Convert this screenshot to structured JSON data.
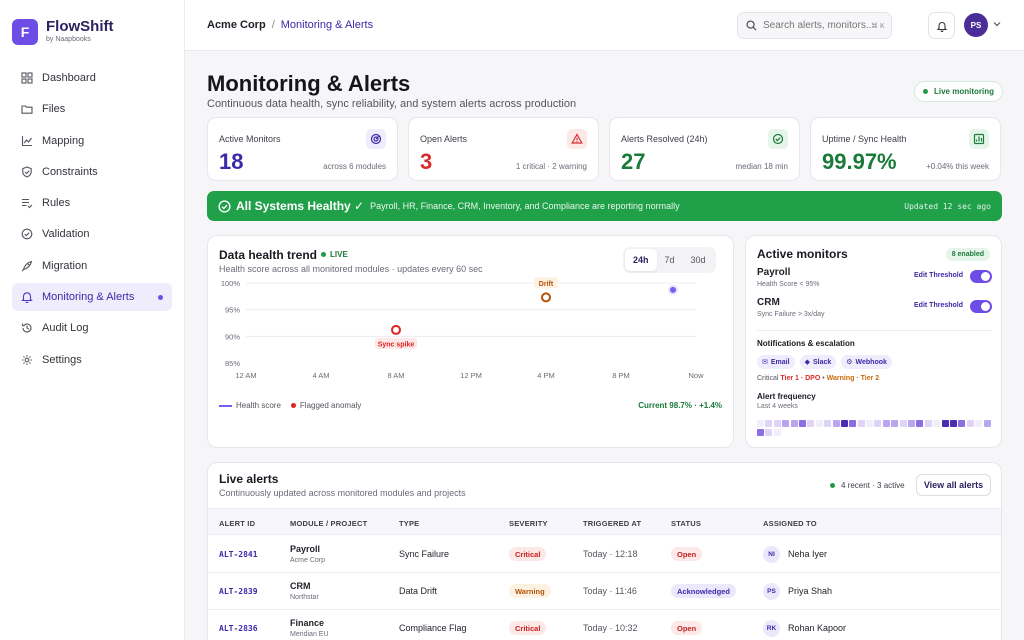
{
  "brand": {
    "logo_letter": "F",
    "name": "FlowShift",
    "sub": "by Naapbooks"
  },
  "sidebar": {
    "items": [
      {
        "label": "Dashboard",
        "icon": "grid-icon"
      },
      {
        "label": "Files",
        "icon": "folder-icon"
      },
      {
        "label": "Mapping",
        "icon": "chart-icon"
      },
      {
        "label": "Constraints",
        "icon": "shield-icon"
      },
      {
        "label": "Rules",
        "icon": "list-check-icon"
      },
      {
        "label": "Validation",
        "icon": "check-circle-icon"
      },
      {
        "label": "Migration",
        "icon": "rocket-icon"
      },
      {
        "label": "Monitoring & Alerts",
        "icon": "bell-alert-icon",
        "active": true
      },
      {
        "label": "Audit Log",
        "icon": "history-icon"
      },
      {
        "label": "Settings",
        "icon": "gear-icon"
      }
    ]
  },
  "topbar": {
    "breadcrumb_root": "Acme Corp",
    "breadcrumb_sep": "/",
    "breadcrumb_current": "Monitoring & Alerts",
    "search_placeholder": "Search alerts, monitors...",
    "search_shortcut": "⌘ K",
    "avatar_initials": "PS"
  },
  "header": {
    "title": "Monitoring & Alerts",
    "subtitle": "Continuous data health, sync reliability, and system alerts across production",
    "live_label": "Live monitoring"
  },
  "kpis": [
    {
      "label": "Active Monitors",
      "value": "18",
      "note": "across 6 modules",
      "color": "#3b2aa8",
      "icon": "radar-icon",
      "icon_bg": "#efecfb"
    },
    {
      "label": "Open Alerts",
      "value": "3",
      "note": "1 critical · 2 warning",
      "color": "#d92d2d",
      "icon": "warning-icon",
      "icon_bg": "#fde8e8"
    },
    {
      "label": "Alerts Resolved (24h)",
      "value": "27",
      "note": "median 18 min",
      "color": "#1a7a3a",
      "icon": "check-circle-icon",
      "icon_bg": "#e6f5ea"
    },
    {
      "label": "Uptime / Sync Health",
      "value": "99.97%",
      "note": "+0.04% this week",
      "color": "#1a7a3a",
      "icon": "chart-up-icon",
      "icon_bg": "#e6f5ea"
    }
  ],
  "banner": {
    "title": "All Systems Healthy ✓",
    "desc": "Payroll, HR, Finance, CRM, Inventory, and Compliance are reporting normally",
    "updated": "Updated 12 sec ago"
  },
  "trend": {
    "title": "Data health trend",
    "live": "LIVE",
    "subtitle": "Health score across all monitored modules · updates every 60 sec",
    "ranges": [
      "24h",
      "7d",
      "30d"
    ],
    "active_range": "24h",
    "legend_health": "Health score",
    "legend_anomaly": "Flagged anomaly",
    "current": "Current 98.7% · +1.4%"
  },
  "chart_data": {
    "type": "line",
    "title": "Data health trend",
    "xlabel": "",
    "ylabel": "",
    "x_ticks": [
      "12 AM",
      "4 AM",
      "8 AM",
      "12 PM",
      "4 PM",
      "8 PM",
      "Now"
    ],
    "y_ticks": [
      "100%",
      "95%",
      "90%",
      "85%"
    ],
    "ylim": [
      85,
      100
    ],
    "series": [
      {
        "name": "Health score",
        "values": []
      }
    ],
    "anomalies": [
      {
        "label": "Sync spike",
        "x": "8 AM",
        "y": 91.2
      },
      {
        "label": "Drift",
        "x": "4 PM",
        "y": 97.3
      }
    ],
    "current_point": {
      "x": "Now",
      "y": 98.7
    },
    "grid": true,
    "legend": "bottom-left"
  },
  "monitors": {
    "title": "Active monitors",
    "enabled_badge": "8 enabled",
    "items": [
      {
        "name": "Payroll",
        "rule": "Health Score < 95%",
        "edit": "Edit Threshold",
        "on": true
      },
      {
        "name": "CRM",
        "rule": "Sync Failure > 3x/day",
        "edit": "Edit Threshold",
        "on": true
      }
    ],
    "notif_title": "Notifications & escalation",
    "channels": [
      {
        "label": "Email",
        "icon": "mail-icon"
      },
      {
        "label": "Slack",
        "icon": "slack-icon"
      },
      {
        "label": "Webhook",
        "icon": "webhook-icon"
      }
    ],
    "escalation": {
      "critical_label": "Critical",
      "critical_path": "Tier 1 · DPO",
      "sep": "•",
      "warning_path": "Warning · Tier 2"
    },
    "freq_title": "Alert frequency",
    "freq_sub": "Last 4 weeks",
    "freq_levels": [
      0,
      1,
      1,
      2,
      2,
      3,
      1,
      0,
      1,
      2,
      4,
      3,
      1,
      0,
      1,
      2,
      2,
      1,
      2,
      3,
      1,
      0,
      4,
      4,
      3,
      1,
      0,
      2,
      3,
      1,
      0
    ]
  },
  "alerts": {
    "title": "Live alerts",
    "subtitle": "Continuously updated across monitored modules and projects",
    "meta": "4 recent · 3 active",
    "view_all": "View all alerts",
    "columns": [
      "ALERT ID",
      "MODULE / PROJECT",
      "TYPE",
      "SEVERITY",
      "TRIGGERED AT",
      "STATUS",
      "ASSIGNED TO"
    ],
    "rows": [
      {
        "id": "ALT-2841",
        "module": "Payroll",
        "project": "Acme Corp",
        "type": "Sync Failure",
        "severity": "Critical",
        "time": "Today · 12:18",
        "status": "Open",
        "initials": "NI",
        "assignee": "Neha Iyer"
      },
      {
        "id": "ALT-2839",
        "module": "CRM",
        "project": "Northstar",
        "type": "Data Drift",
        "severity": "Warning",
        "time": "Today · 11:46",
        "status": "Acknowledged",
        "initials": "PS",
        "assignee": "Priya Shah"
      },
      {
        "id": "ALT-2836",
        "module": "Finance",
        "project": "Meridian EU",
        "type": "Compliance Flag",
        "severity": "Critical",
        "time": "Today · 10:32",
        "status": "Open",
        "initials": "RK",
        "assignee": "Rohan Kapoor"
      }
    ]
  }
}
